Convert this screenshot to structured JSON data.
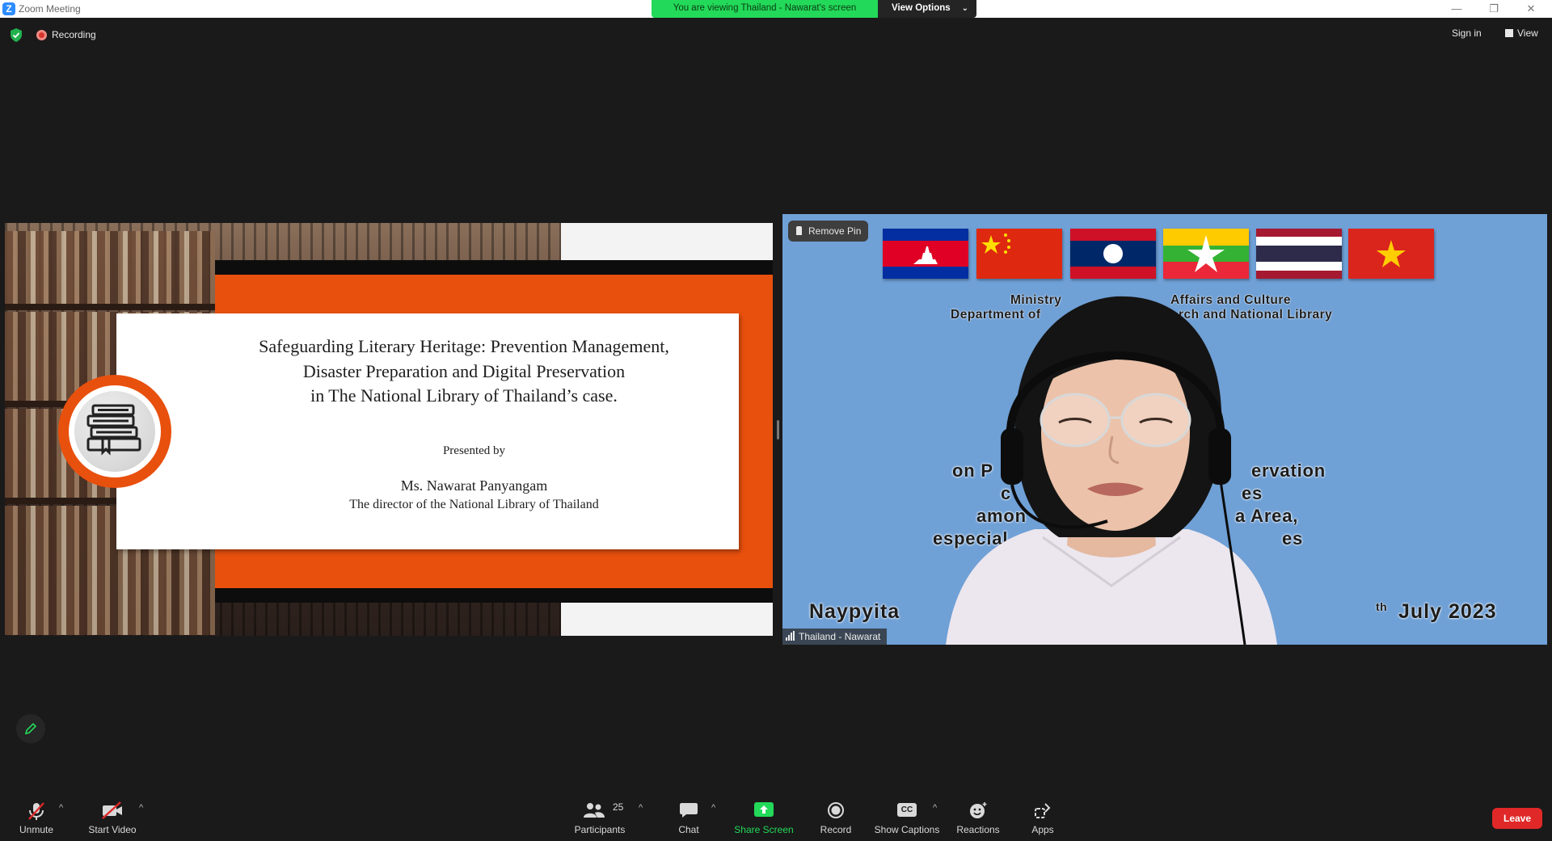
{
  "window": {
    "title": "Zoom Meeting",
    "logo_letter": "Z",
    "minimize": "—",
    "restore": "❐",
    "close": "✕"
  },
  "banner": {
    "viewing_text": "You are viewing Thailand - Nawarat's screen",
    "view_options_label": "View Options",
    "chevron": "⌄"
  },
  "status": {
    "recording_label": "Recording",
    "sign_in_label": "Sign in",
    "view_label": "View"
  },
  "slide": {
    "title_lines": [
      "Safeguarding Literary Heritage: Prevention Management,",
      "Disaster Preparation and Digital Preservation",
      "in The National Library of Thailand’s case."
    ],
    "presented_by": "Presented by",
    "presenter_name": "Ms. Nawarat Panyangam",
    "presenter_role": "The director of the National Library of Thailand"
  },
  "speaker": {
    "remove_pin_label": "Remove Pin",
    "name_tag": "Thailand - Nawarat",
    "backdrop_lines": {
      "ministry": "Ministry",
      "affairs": "Affairs and Culture",
      "department": "Department of",
      "research": "rch and National Library",
      "on_p": "on P",
      "ervation": "ervation",
      "c": "c",
      "es1": "es",
      "amon": "amon",
      "area": "a Area,",
      "especial": "especial",
      "es2": "es",
      "naypyita": "Naypyita",
      "th": "th",
      "july": "July 2023"
    },
    "flags": [
      "cambodia",
      "china",
      "laos",
      "myanmar",
      "thailand",
      "vietnam"
    ]
  },
  "toolbar": {
    "unmute": "Unmute",
    "start_video": "Start Video",
    "participants": "Participants",
    "participants_count": "25",
    "chat": "Chat",
    "share_screen": "Share Screen",
    "record": "Record",
    "show_captions": "Show Captions",
    "cc": "CC",
    "reactions": "Reactions",
    "apps": "Apps",
    "leave": "Leave",
    "caret": "^"
  },
  "colors": {
    "zoom_blue": "#2d8cff",
    "share_green": "#23d959",
    "leave_red": "#e02828",
    "slide_orange": "#e8500d"
  }
}
